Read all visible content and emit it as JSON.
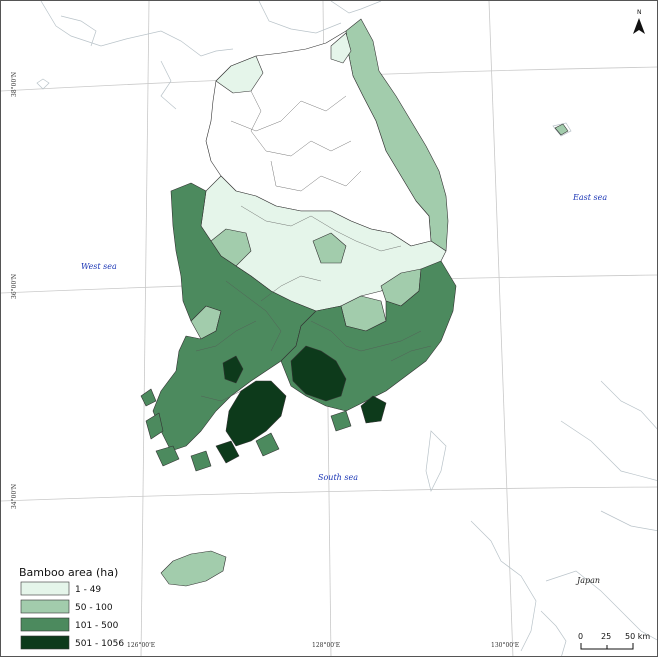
{
  "legend": {
    "title": "Bamboo area (ha)",
    "classes": [
      {
        "label": "1 - 49",
        "color": "#e5f5ea"
      },
      {
        "label": "50 - 100",
        "color": "#a2ccac"
      },
      {
        "label": "101 - 500",
        "color": "#4c8a5e"
      },
      {
        "label": "501 - 1056",
        "color": "#0d3a1b"
      }
    ]
  },
  "sea_labels": {
    "west": "West sea",
    "east": "East sea",
    "south": "South sea"
  },
  "land_labels": {
    "japan": "Japan"
  },
  "coordinates": {
    "lat_38": "38°00'N",
    "lat_36": "36°00'N",
    "lat_34": "34°00'N",
    "lon_126": "126°00'E",
    "lon_128": "128°00'E",
    "lon_130": "130°00'E"
  },
  "north_arrow": {
    "label": "N"
  },
  "scale_bar": {
    "ticks": [
      "0",
      "25",
      "50 km"
    ]
  },
  "colors": {
    "no_data": "#ffffff",
    "boundary": "#333333",
    "water_labels": "#1a35b5"
  }
}
